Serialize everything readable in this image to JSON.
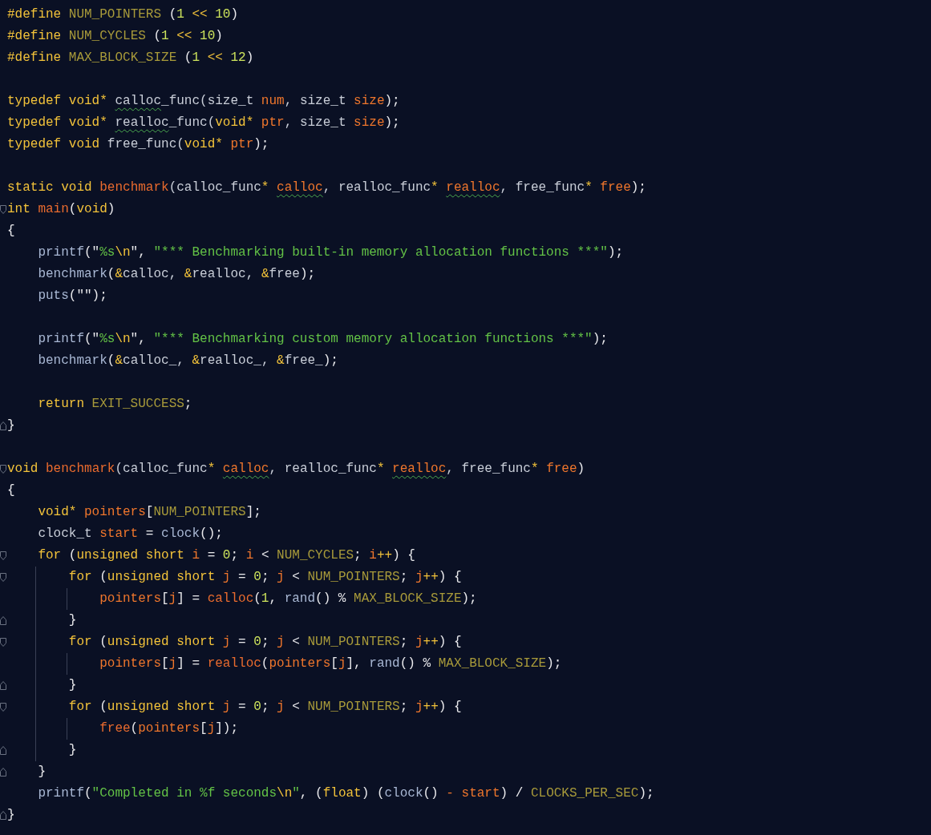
{
  "editor": {
    "lines": [
      {
        "kind": "code",
        "tokens": [
          {
            "text": "#define ",
            "kind": "kw"
          },
          {
            "text": "NUM_POINTERS",
            "kind": "macro"
          },
          {
            "text": " (",
            "kind": "punct"
          },
          {
            "text": "1",
            "kind": "num"
          },
          {
            "text": " << ",
            "kind": "kw"
          },
          {
            "text": "10",
            "kind": "num"
          },
          {
            "text": ")",
            "kind": "punct"
          }
        ]
      },
      {
        "kind": "code",
        "tokens": [
          {
            "text": "#define ",
            "kind": "kw"
          },
          {
            "text": "NUM_CYCLES",
            "kind": "macro"
          },
          {
            "text": " (",
            "kind": "punct"
          },
          {
            "text": "1",
            "kind": "num"
          },
          {
            "text": " << ",
            "kind": "kw"
          },
          {
            "text": "10",
            "kind": "num"
          },
          {
            "text": ")",
            "kind": "punct"
          }
        ]
      },
      {
        "kind": "code",
        "tokens": [
          {
            "text": "#define ",
            "kind": "kw"
          },
          {
            "text": "MAX_BLOCK_SIZE",
            "kind": "macro"
          },
          {
            "text": " (",
            "kind": "punct"
          },
          {
            "text": "1",
            "kind": "num"
          },
          {
            "text": " << ",
            "kind": "kw"
          },
          {
            "text": "12",
            "kind": "num"
          },
          {
            "text": ")",
            "kind": "punct"
          }
        ]
      },
      {
        "kind": "blank"
      },
      {
        "kind": "code",
        "tokens": [
          {
            "text": "typedef void* ",
            "kind": "kw"
          },
          {
            "text": "calloc",
            "kind": "plain",
            "warning": true
          },
          {
            "text": "_func(size_t ",
            "kind": "plain"
          },
          {
            "text": "num",
            "kind": "var"
          },
          {
            "text": ", size_t ",
            "kind": "plain"
          },
          {
            "text": "size",
            "kind": "var"
          },
          {
            "text": ");",
            "kind": "punct"
          }
        ]
      },
      {
        "kind": "code",
        "tokens": [
          {
            "text": "typedef void* ",
            "kind": "kw"
          },
          {
            "text": "realloc",
            "kind": "plain",
            "warning": true
          },
          {
            "text": "_func(",
            "kind": "plain"
          },
          {
            "text": "void* ",
            "kind": "kw"
          },
          {
            "text": "ptr",
            "kind": "var"
          },
          {
            "text": ", size_t ",
            "kind": "plain"
          },
          {
            "text": "size",
            "kind": "var"
          },
          {
            "text": ");",
            "kind": "punct"
          }
        ]
      },
      {
        "kind": "code",
        "tokens": [
          {
            "text": "typedef void ",
            "kind": "kw"
          },
          {
            "text": "free_func(",
            "kind": "plain"
          },
          {
            "text": "void* ",
            "kind": "kw"
          },
          {
            "text": "ptr",
            "kind": "var"
          },
          {
            "text": ");",
            "kind": "punct"
          }
        ]
      },
      {
        "kind": "blank"
      },
      {
        "kind": "code",
        "tokens": [
          {
            "text": "static void ",
            "kind": "kw"
          },
          {
            "text": "benchmark",
            "kind": "fn"
          },
          {
            "text": "(calloc_func",
            "kind": "plain"
          },
          {
            "text": "* ",
            "kind": "kw"
          },
          {
            "text": "calloc",
            "kind": "var",
            "warning": true
          },
          {
            "text": ", realloc_func",
            "kind": "plain"
          },
          {
            "text": "* ",
            "kind": "kw"
          },
          {
            "text": "realloc",
            "kind": "var",
            "warning": true
          },
          {
            "text": ", free_func",
            "kind": "plain"
          },
          {
            "text": "* ",
            "kind": "kw"
          },
          {
            "text": "free",
            "kind": "var"
          },
          {
            "text": ");",
            "kind": "punct"
          }
        ]
      },
      {
        "kind": "code",
        "fold_start": true,
        "tokens": [
          {
            "text": "int ",
            "kind": "kw"
          },
          {
            "text": "main",
            "kind": "fn"
          },
          {
            "text": "(",
            "kind": "punct"
          },
          {
            "text": "void",
            "kind": "kw"
          },
          {
            "text": ")",
            "kind": "punct"
          }
        ]
      },
      {
        "kind": "code",
        "tokens": [
          {
            "text": "{",
            "kind": "punct"
          }
        ]
      },
      {
        "kind": "code",
        "tokens": [
          {
            "text": "    printf",
            "kind": "call"
          },
          {
            "text": "(\"",
            "kind": "punct"
          },
          {
            "text": "%s",
            "kind": "str"
          },
          {
            "text": "\\n",
            "kind": "esc"
          },
          {
            "text": "\", ",
            "kind": "punct"
          },
          {
            "text": "\"*** Benchmarking built-in memory allocation functions ***\"",
            "kind": "str"
          },
          {
            "text": ");",
            "kind": "punct"
          }
        ]
      },
      {
        "kind": "code",
        "tokens": [
          {
            "text": "    benchmark",
            "kind": "call"
          },
          {
            "text": "(",
            "kind": "punct"
          },
          {
            "text": "&",
            "kind": "kw"
          },
          {
            "text": "calloc, ",
            "kind": "plain"
          },
          {
            "text": "&",
            "kind": "kw"
          },
          {
            "text": "realloc, ",
            "kind": "plain"
          },
          {
            "text": "&",
            "kind": "kw"
          },
          {
            "text": "free",
            "kind": "plain"
          },
          {
            "text": ");",
            "kind": "punct"
          }
        ]
      },
      {
        "kind": "code",
        "tokens": [
          {
            "text": "    puts",
            "kind": "call"
          },
          {
            "text": "(\"\");",
            "kind": "punct"
          }
        ]
      },
      {
        "kind": "blank"
      },
      {
        "kind": "code",
        "tokens": [
          {
            "text": "    printf",
            "kind": "call"
          },
          {
            "text": "(\"",
            "kind": "punct"
          },
          {
            "text": "%s",
            "kind": "str"
          },
          {
            "text": "\\n",
            "kind": "esc"
          },
          {
            "text": "\", ",
            "kind": "punct"
          },
          {
            "text": "\"*** Benchmarking custom memory allocation functions ***\"",
            "kind": "str"
          },
          {
            "text": ");",
            "kind": "punct"
          }
        ]
      },
      {
        "kind": "code",
        "tokens": [
          {
            "text": "    benchmark",
            "kind": "call"
          },
          {
            "text": "(",
            "kind": "punct"
          },
          {
            "text": "&",
            "kind": "kw"
          },
          {
            "text": "calloc_, ",
            "kind": "plain"
          },
          {
            "text": "&",
            "kind": "kw"
          },
          {
            "text": "realloc_, ",
            "kind": "plain"
          },
          {
            "text": "&",
            "kind": "kw"
          },
          {
            "text": "free_",
            "kind": "plain"
          },
          {
            "text": ");",
            "kind": "punct"
          }
        ]
      },
      {
        "kind": "blank"
      },
      {
        "kind": "code",
        "tokens": [
          {
            "text": "    return ",
            "kind": "kw"
          },
          {
            "text": "EXIT_SUCCESS",
            "kind": "macro"
          },
          {
            "text": ";",
            "kind": "punct"
          }
        ]
      },
      {
        "kind": "code",
        "fold_end": true,
        "tokens": [
          {
            "text": "}",
            "kind": "punct"
          }
        ]
      },
      {
        "kind": "blank"
      },
      {
        "kind": "code",
        "fold_start": true,
        "tokens": [
          {
            "text": "void ",
            "kind": "kw"
          },
          {
            "text": "benchmark",
            "kind": "fn"
          },
          {
            "text": "(calloc_func",
            "kind": "plain"
          },
          {
            "text": "* ",
            "kind": "kw"
          },
          {
            "text": "calloc",
            "kind": "var",
            "warning": true
          },
          {
            "text": ", realloc_func",
            "kind": "plain"
          },
          {
            "text": "* ",
            "kind": "kw"
          },
          {
            "text": "realloc",
            "kind": "var",
            "warning": true
          },
          {
            "text": ", free_func",
            "kind": "plain"
          },
          {
            "text": "* ",
            "kind": "kw"
          },
          {
            "text": "free",
            "kind": "var"
          },
          {
            "text": ")",
            "kind": "punct"
          }
        ]
      },
      {
        "kind": "code",
        "tokens": [
          {
            "text": "{",
            "kind": "punct"
          }
        ]
      },
      {
        "kind": "code",
        "tokens": [
          {
            "text": "    void* ",
            "kind": "kw"
          },
          {
            "text": "pointers",
            "kind": "var"
          },
          {
            "text": "[",
            "kind": "punct"
          },
          {
            "text": "NUM_POINTERS",
            "kind": "macro"
          },
          {
            "text": "];",
            "kind": "punct"
          }
        ]
      },
      {
        "kind": "code",
        "tokens": [
          {
            "text": "    clock_t ",
            "kind": "plain"
          },
          {
            "text": "start",
            "kind": "var"
          },
          {
            "text": " = ",
            "kind": "punct"
          },
          {
            "text": "clock",
            "kind": "call"
          },
          {
            "text": "();",
            "kind": "punct"
          }
        ]
      },
      {
        "kind": "code",
        "fold_start": true,
        "tokens": [
          {
            "text": "    for ",
            "kind": "kw"
          },
          {
            "text": "(",
            "kind": "punct"
          },
          {
            "text": "unsigned short ",
            "kind": "kw"
          },
          {
            "text": "i",
            "kind": "var"
          },
          {
            "text": " = ",
            "kind": "punct"
          },
          {
            "text": "0",
            "kind": "num"
          },
          {
            "text": "; ",
            "kind": "punct"
          },
          {
            "text": "i",
            "kind": "var"
          },
          {
            "text": " < ",
            "kind": "punct"
          },
          {
            "text": "NUM_CYCLES",
            "kind": "macro"
          },
          {
            "text": "; ",
            "kind": "punct"
          },
          {
            "text": "i",
            "kind": "var"
          },
          {
            "text": "++",
            "kind": "kw"
          },
          {
            "text": ") {",
            "kind": "punct"
          }
        ]
      },
      {
        "kind": "code",
        "fold_start": true,
        "tokens": [
          {
            "text": "        for ",
            "kind": "kw"
          },
          {
            "text": "(",
            "kind": "punct"
          },
          {
            "text": "unsigned short ",
            "kind": "kw"
          },
          {
            "text": "j",
            "kind": "var"
          },
          {
            "text": " = ",
            "kind": "punct"
          },
          {
            "text": "0",
            "kind": "num"
          },
          {
            "text": "; ",
            "kind": "punct"
          },
          {
            "text": "j",
            "kind": "var"
          },
          {
            "text": " < ",
            "kind": "punct"
          },
          {
            "text": "NUM_POINTERS",
            "kind": "macro"
          },
          {
            "text": "; ",
            "kind": "punct"
          },
          {
            "text": "j",
            "kind": "var"
          },
          {
            "text": "++",
            "kind": "kw"
          },
          {
            "text": ") {",
            "kind": "punct"
          }
        ]
      },
      {
        "kind": "code",
        "tokens": [
          {
            "text": "            pointers",
            "kind": "var"
          },
          {
            "text": "[",
            "kind": "punct"
          },
          {
            "text": "j",
            "kind": "var"
          },
          {
            "text": "] = ",
            "kind": "punct"
          },
          {
            "text": "calloc",
            "kind": "fn"
          },
          {
            "text": "(",
            "kind": "punct"
          },
          {
            "text": "1",
            "kind": "num"
          },
          {
            "text": ", ",
            "kind": "punct"
          },
          {
            "text": "rand",
            "kind": "call"
          },
          {
            "text": "() % ",
            "kind": "punct"
          },
          {
            "text": "MAX_BLOCK_SIZE",
            "kind": "macro"
          },
          {
            "text": ");",
            "kind": "punct"
          }
        ]
      },
      {
        "kind": "code",
        "fold_end": true,
        "tokens": [
          {
            "text": "        }",
            "kind": "punct"
          }
        ]
      },
      {
        "kind": "code",
        "fold_start": true,
        "tokens": [
          {
            "text": "        for ",
            "kind": "kw"
          },
          {
            "text": "(",
            "kind": "punct"
          },
          {
            "text": "unsigned short ",
            "kind": "kw"
          },
          {
            "text": "j",
            "kind": "var"
          },
          {
            "text": " = ",
            "kind": "punct"
          },
          {
            "text": "0",
            "kind": "num"
          },
          {
            "text": "; ",
            "kind": "punct"
          },
          {
            "text": "j",
            "kind": "var"
          },
          {
            "text": " < ",
            "kind": "punct"
          },
          {
            "text": "NUM_POINTERS",
            "kind": "macro"
          },
          {
            "text": "; ",
            "kind": "punct"
          },
          {
            "text": "j",
            "kind": "var"
          },
          {
            "text": "++",
            "kind": "kw"
          },
          {
            "text": ") {",
            "kind": "punct"
          }
        ]
      },
      {
        "kind": "code",
        "tokens": [
          {
            "text": "            pointers",
            "kind": "var"
          },
          {
            "text": "[",
            "kind": "punct"
          },
          {
            "text": "j",
            "kind": "var"
          },
          {
            "text": "] = ",
            "kind": "punct"
          },
          {
            "text": "realloc",
            "kind": "fn"
          },
          {
            "text": "(",
            "kind": "punct"
          },
          {
            "text": "pointers",
            "kind": "var"
          },
          {
            "text": "[",
            "kind": "punct"
          },
          {
            "text": "j",
            "kind": "var"
          },
          {
            "text": "], ",
            "kind": "punct"
          },
          {
            "text": "rand",
            "kind": "call"
          },
          {
            "text": "() % ",
            "kind": "punct"
          },
          {
            "text": "MAX_BLOCK_SIZE",
            "kind": "macro"
          },
          {
            "text": ");",
            "kind": "punct"
          }
        ]
      },
      {
        "kind": "code",
        "fold_end": true,
        "tokens": [
          {
            "text": "        }",
            "kind": "punct"
          }
        ]
      },
      {
        "kind": "code",
        "fold_start": true,
        "tokens": [
          {
            "text": "        for ",
            "kind": "kw"
          },
          {
            "text": "(",
            "kind": "punct"
          },
          {
            "text": "unsigned short ",
            "kind": "kw"
          },
          {
            "text": "j",
            "kind": "var"
          },
          {
            "text": " = ",
            "kind": "punct"
          },
          {
            "text": "0",
            "kind": "num"
          },
          {
            "text": "; ",
            "kind": "punct"
          },
          {
            "text": "j",
            "kind": "var"
          },
          {
            "text": " < ",
            "kind": "punct"
          },
          {
            "text": "NUM_POINTERS",
            "kind": "macro"
          },
          {
            "text": "; ",
            "kind": "punct"
          },
          {
            "text": "j",
            "kind": "var"
          },
          {
            "text": "++",
            "kind": "kw"
          },
          {
            "text": ") {",
            "kind": "punct"
          }
        ]
      },
      {
        "kind": "code",
        "tokens": [
          {
            "text": "            free",
            "kind": "fn"
          },
          {
            "text": "(",
            "kind": "punct"
          },
          {
            "text": "pointers",
            "kind": "var"
          },
          {
            "text": "[",
            "kind": "punct"
          },
          {
            "text": "j",
            "kind": "var"
          },
          {
            "text": "]);",
            "kind": "punct"
          }
        ]
      },
      {
        "kind": "code",
        "fold_end": true,
        "tokens": [
          {
            "text": "        }",
            "kind": "punct"
          }
        ]
      },
      {
        "kind": "code",
        "fold_end": true,
        "tokens": [
          {
            "text": "    }",
            "kind": "punct"
          }
        ]
      },
      {
        "kind": "code",
        "tokens": [
          {
            "text": "    printf",
            "kind": "call"
          },
          {
            "text": "(",
            "kind": "punct"
          },
          {
            "text": "\"Completed in %f seconds",
            "kind": "str"
          },
          {
            "text": "\\n",
            "kind": "esc"
          },
          {
            "text": "\"",
            "kind": "str"
          },
          {
            "text": ", (",
            "kind": "punct"
          },
          {
            "text": "float",
            "kind": "kw"
          },
          {
            "text": ") (",
            "kind": "punct"
          },
          {
            "text": "clock",
            "kind": "call"
          },
          {
            "text": "() ",
            "kind": "punct"
          },
          {
            "text": "- start",
            "kind": "var"
          },
          {
            "text": ") / ",
            "kind": "punct"
          },
          {
            "text": "CLOCKS_PER_SEC",
            "kind": "macro"
          },
          {
            "text": ");",
            "kind": "punct"
          }
        ]
      },
      {
        "kind": "code",
        "fold_end": true,
        "tokens": [
          {
            "text": "}",
            "kind": "punct"
          }
        ]
      }
    ]
  }
}
